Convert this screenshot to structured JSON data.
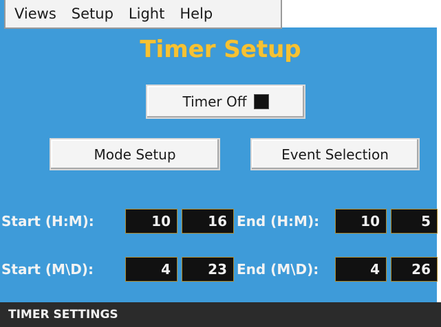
{
  "menu": {
    "items": [
      "Views",
      "Setup",
      "Light",
      "Help"
    ]
  },
  "title": "Timer Setup",
  "timer_toggle": {
    "label": "Timer Off",
    "state": "off"
  },
  "buttons": {
    "mode_setup": "Mode Setup",
    "event_selection": "Event Selection"
  },
  "time_row": {
    "start_label": "Start (H:M):",
    "start_hour": "10",
    "start_minute": "16",
    "end_label": "End (H:M):",
    "end_hour": "10",
    "end_minute": "5"
  },
  "date_row": {
    "start_label": "Start (M\\D):",
    "start_month": "4",
    "start_day": "23",
    "end_label": "End (M\\D):",
    "end_month": "4",
    "end_day": "26"
  },
  "status": "TIMER SETTINGS",
  "colors": {
    "background": "#3e9bd9",
    "title": "#f6c233",
    "statusbar": "#2b2b2b"
  }
}
